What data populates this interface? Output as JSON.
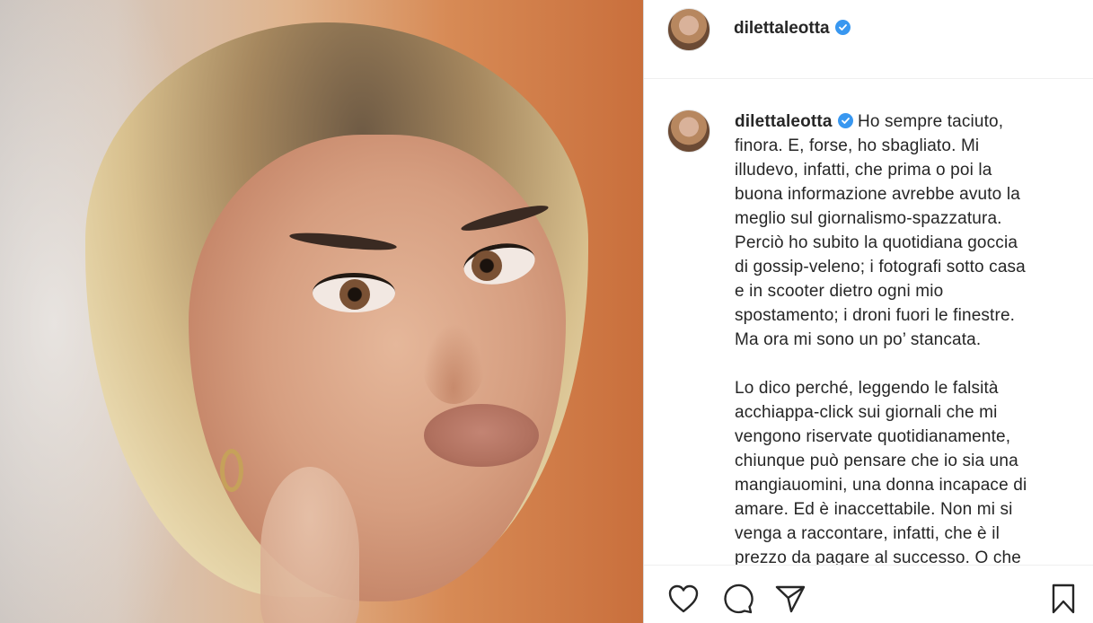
{
  "post": {
    "username": "dilettaleotta",
    "verified": true
  },
  "caption": {
    "lines_p1": [
      "Ho sempre taciuto,",
      "finora. E, forse, ho sbagliato. Mi",
      "illudevo, infatti, che prima o poi la",
      "buona informazione avrebbe avuto la",
      "meglio sul giornalismo-spazzatura.",
      "Perciò ho subito la quotidiana goccia",
      "di gossip-veleno; i fotografi sotto casa",
      "e in scooter dietro ogni mio",
      "spostamento; i droni fuori le finestre.",
      "Ma ora mi sono un po’ stancata."
    ],
    "lines_p2": [
      "Lo dico perché, leggendo le falsità",
      "acchiappa-click sui giornali che mi",
      "vengono riservate quotidianamente,",
      "chiunque può pensare che io sia una",
      "mangiauomini, una donna incapace di",
      "amare. Ed è inaccettabile. Non mi si",
      "venga a raccontare, infatti, che è il",
      "prezzo da pagare al successo. O che"
    ]
  },
  "icons": {
    "like": "heart-icon",
    "comment": "comment-icon",
    "share": "paper-plane-icon",
    "save": "bookmark-icon",
    "verified": "verified-badge-icon"
  },
  "colors": {
    "verified_blue": "#3897f0",
    "text": "#262626"
  }
}
